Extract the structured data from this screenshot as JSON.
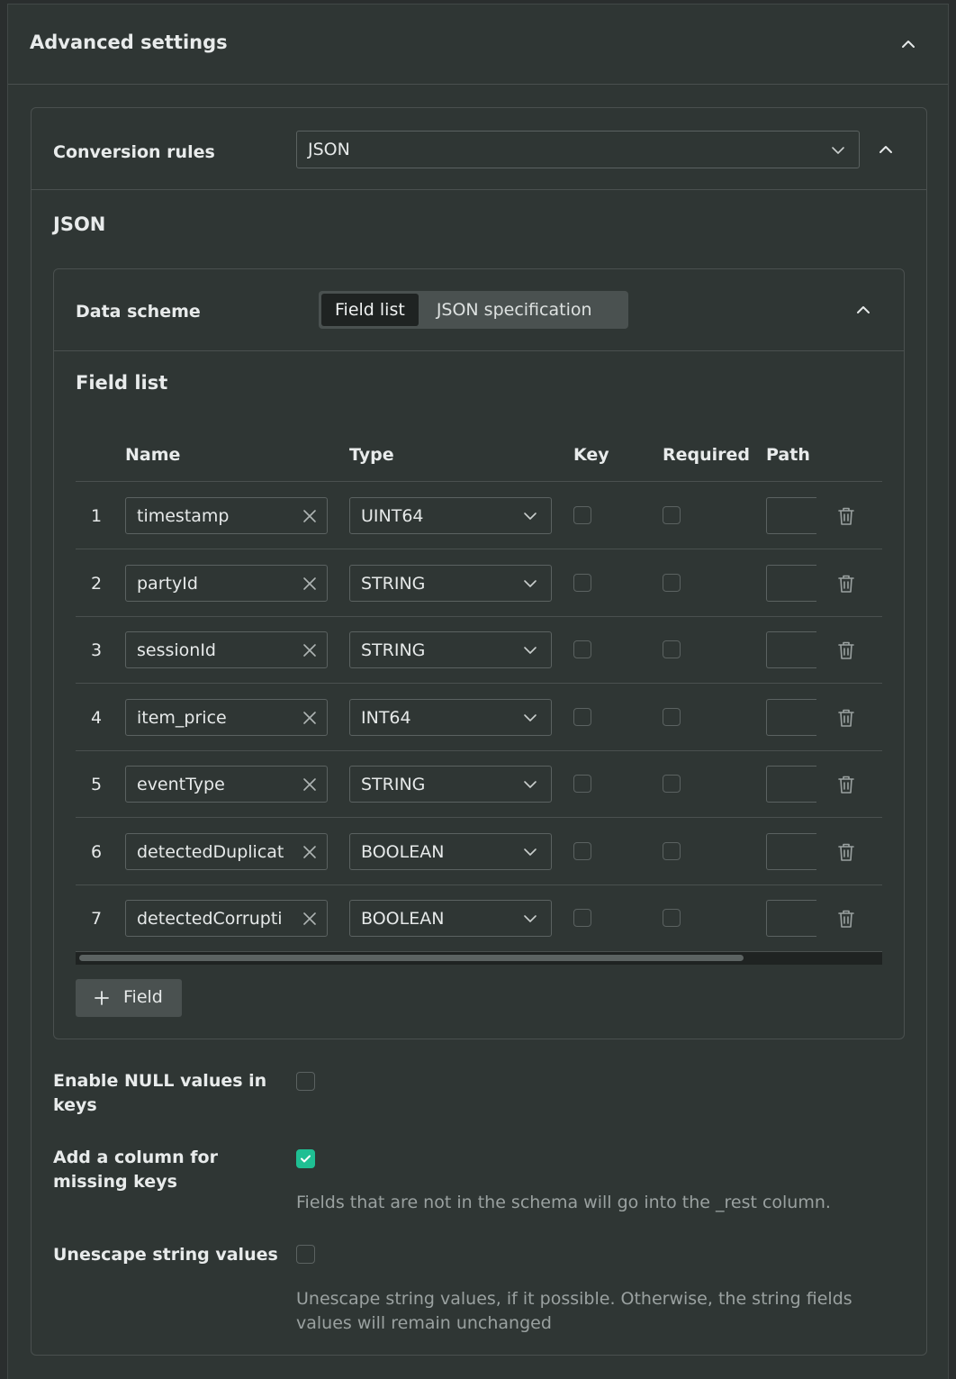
{
  "panel": {
    "title": "Advanced settings"
  },
  "conversion": {
    "label": "Conversion rules",
    "selected": "JSON",
    "section_title": "JSON"
  },
  "scheme": {
    "label": "Data scheme",
    "tabs": [
      "Field list",
      "JSON specification"
    ],
    "active_tab": "Field list",
    "field_list_title": "Field list"
  },
  "table": {
    "headers": {
      "name": "Name",
      "type": "Type",
      "key": "Key",
      "required": "Required",
      "path": "Path"
    },
    "rows": [
      {
        "num": "1",
        "name": "timestamp",
        "type": "UINT64",
        "key": false,
        "required": false,
        "path": ""
      },
      {
        "num": "2",
        "name": "partyId",
        "type": "STRING",
        "key": false,
        "required": false,
        "path": ""
      },
      {
        "num": "3",
        "name": "sessionId",
        "type": "STRING",
        "key": false,
        "required": false,
        "path": ""
      },
      {
        "num": "4",
        "name": "item_price",
        "type": "INT64",
        "key": false,
        "required": false,
        "path": ""
      },
      {
        "num": "5",
        "name": "eventType",
        "type": "STRING",
        "key": false,
        "required": false,
        "path": ""
      },
      {
        "num": "6",
        "name": "detectedDuplicat",
        "type": "BOOLEAN",
        "key": false,
        "required": false,
        "path": ""
      },
      {
        "num": "7",
        "name": "detectedCorrupti",
        "type": "BOOLEAN",
        "key": false,
        "required": false,
        "path": ""
      }
    ],
    "add_button": "Field"
  },
  "options": {
    "null_keys": {
      "label": "Enable NULL values in keys",
      "checked": false
    },
    "missing_keys": {
      "label": "Add a column for missing keys",
      "checked": true,
      "hint": "Fields that are not in the schema will go into the _rest column."
    },
    "unescape": {
      "label": "Unescape string values",
      "checked": false,
      "hint": "Unescape string values, if it possible. Otherwise, the string fields values will remain unchanged"
    }
  },
  "colors": {
    "accent": "#1fbf93",
    "background": "#2f3634",
    "border": "#4a504f"
  },
  "icons": [
    "chevron-up-icon",
    "chevron-down-icon",
    "close-icon",
    "trash-icon",
    "plus-icon",
    "check-icon"
  ]
}
